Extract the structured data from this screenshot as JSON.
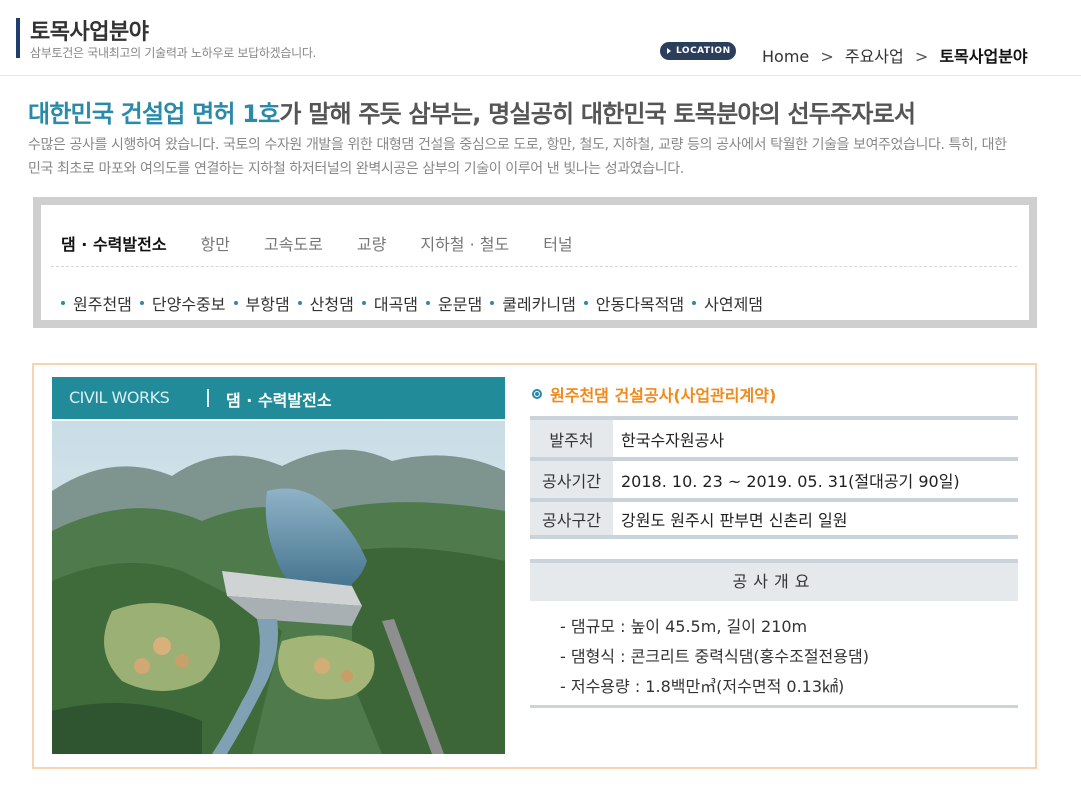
{
  "header": {
    "title": "토목사업분야",
    "subtitle": "삼부토건은 국내최고의 기술력과 노하우로 보답하겠습니다.",
    "location_badge": "LOCATION",
    "breadcrumb": [
      "Home",
      "주요사업",
      "토목사업분야"
    ],
    "breadcrumb_sep": ">"
  },
  "intro": {
    "headline_accent": "대한민국 건설업 면허 1호",
    "headline_rest": "가 말해 주듯 삼부는, 명실공히 대한민국 토목분야의 선두주자로서",
    "text": "수많은 공사를 시행하여 왔습니다. 국토의 수자원 개발을 위한 대형댐 건설을 중심으로 도로, 항만, 철도, 지하철, 교량 등의 공사에서 탁월한 기술을 보여주었습니다. 특히, 대한민국 최초로 마포와  여의도를 연결하는 지하철 하저터널의 완벽시공은 삼부의 기술이 이루어 낸 빛나는 성과였습니다."
  },
  "categories": {
    "tabs": [
      "댐 · 수력발전소",
      "항만",
      "고속도로",
      "교량",
      "지하철 · 철도",
      "터널"
    ],
    "active_tab": 0,
    "items": [
      "원주천댐",
      "단양수중보",
      "부항댐",
      "산청댐",
      "대곡댐",
      "운문댐",
      "쿨레카니댐",
      "안동다목적댐",
      "사연제댐"
    ]
  },
  "detail": {
    "photo_header": {
      "label": "CIVIL WORKS",
      "category": "댐 · 수력발전소"
    },
    "photo_alt": "dam-aerial-render",
    "project_title": "원주천댐 건설공사(사업관리계약)",
    "rows": [
      {
        "label": "발주처",
        "value": "한국수자원공사"
      },
      {
        "label": "공사기간",
        "value": "2018. 10. 23 ~ 2019. 05. 31(절대공기 90일)"
      },
      {
        "label": "공사구간",
        "value": "강원도 원주시 판부면 신촌리 일원"
      }
    ],
    "overview_title": "공사개요",
    "overview": [
      "- 댐규모 : 높이 45.5m, 길이 210m",
      "- 댐형식 : 콘크리트 중력식댐(홍수조절전용댐)",
      "- 저수용량 : 1.8백만㎥(저수면적 0.13㎢)"
    ]
  },
  "colors": {
    "accent_teal": "#2a8aa8",
    "header_teal": "#218b9a",
    "title_orange": "#ef8a1c",
    "border_peach": "#f7d4ad",
    "location_navy": "#2b3f5c"
  }
}
